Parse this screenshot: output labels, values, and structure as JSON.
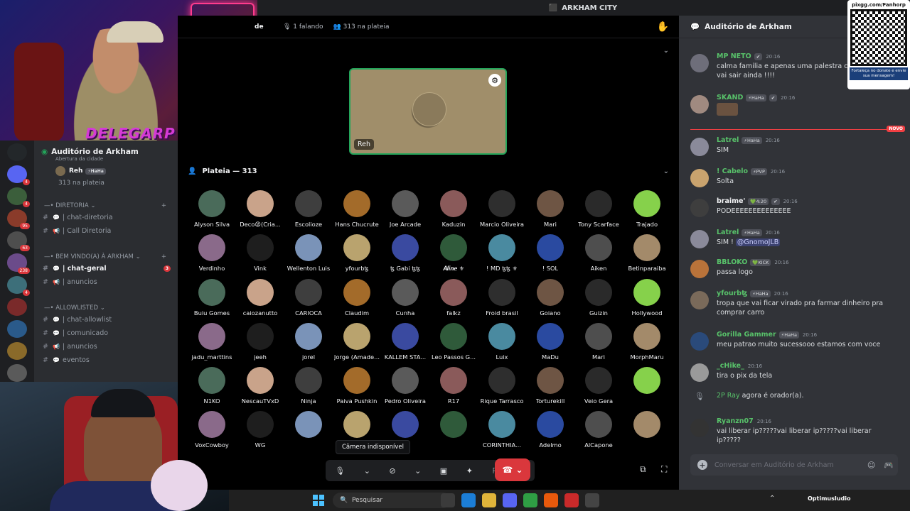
{
  "window": {
    "title": "ARKHAM CITY"
  },
  "overlay": {
    "brand": "DELEGARP"
  },
  "stage": {
    "title_fragment": "de",
    "speaking": "1 falando",
    "audience_count": "313 na plateia",
    "speaker": {
      "name": "Reh"
    },
    "audience_title": "Plateia — 313"
  },
  "sidebar": {
    "voice_channel": {
      "name": "Auditório de Arkham",
      "subtitle": "Abertura da cidade",
      "speaker": "Reh",
      "speaker_tag": "⚡HaHa",
      "audience": "313 na plateia"
    },
    "categories": [
      {
        "name": "DIRETORIA",
        "channels": [
          "| chat-diretoria",
          "| Call Diretoria"
        ]
      },
      {
        "name": "BEM VINDO(A) À ARKHAM",
        "channels": [
          "| chat-geral",
          "| anuncios"
        ]
      },
      {
        "name": "ALLOWLISTED",
        "channels": [
          "| chat-allowlist",
          "| comunicado",
          "| anuncios",
          "eventos"
        ]
      }
    ],
    "active_channel_mentions": "3",
    "server_badges": [
      "17",
      "4",
      "4",
      "95",
      "63",
      "238",
      "4"
    ]
  },
  "audience": [
    "Alyson Silva",
    "Deco😡(Cria...",
    "Escolioze",
    "Hans Chucrute",
    "Joe Arcade",
    "Kaduzin",
    "Marcio Oliveira",
    "Mari",
    "Tony Scarface",
    "Trajado",
    "Verdinho",
    "Vink",
    "Wellenton Luis",
    "yfourbꜩ",
    "ꜩ Gabi ꜩꜩ",
    "𝑨𝒍𝒊𝒏𝒆 ⚜",
    "! MD ꜩꜩ ⚜",
    "! SOL",
    "Aiken",
    "Betinparaiba",
    "Buiu Gomes",
    "caiozanutto",
    "CARIOCA",
    "Claudim",
    "Cunha",
    "falkz",
    "Froid brasil",
    "Goiano",
    "Guizin",
    "Hollywood",
    "jadu_marttins",
    "jeeh",
    "jorel",
    "Jorge (Amade...",
    "KALLEM STA...",
    "Leo Passos G...",
    "Luix",
    "MaDu",
    "Mari",
    "MorphMaru",
    "N1KO",
    "NescauTVxD",
    "Ninja",
    "Paiva Pushkin",
    "Pedro Oliveira",
    "R17",
    "Rique Tarrasco",
    "Torturekill",
    "Veio Gera",
    "",
    "VoxCowboy",
    "WG",
    "",
    "",
    "",
    "",
    "CORINTHIA...",
    "Adelmo",
    "AlCapone",
    ""
  ],
  "controls": {
    "tooltip": "Câmera indisponível"
  },
  "chat": {
    "title": "Auditório de Arkham",
    "new_label": "NOVO",
    "input_placeholder": "Conversar em Auditório de Arkham",
    "messages": [
      {
        "author": "MP NETO",
        "tags": [
          "✔"
        ],
        "time": "20:16",
        "color": "#58c26a",
        "text": "calma familia e apenas uma palestra com spoler vai sair ainda !!!!"
      },
      {
        "author": "SKAND",
        "tags": [
          "⚡HaHa",
          "✔"
        ],
        "time": "20:16",
        "color": "#58c26a",
        "text": ""
      },
      {
        "author": "Latrel",
        "tags": [
          "⚡HaHa"
        ],
        "time": "20:16",
        "color": "#58c26a",
        "text": "SIM"
      },
      {
        "author": "! Cabelo",
        "tags": [
          "⚡PVP"
        ],
        "time": "20:16",
        "color": "#58c26a",
        "text": "Solta"
      },
      {
        "author": "braime'",
        "tags": [
          "💚4:20",
          "✔"
        ],
        "time": "20:16",
        "color": "#f2f3f5",
        "text": "PODEEEEEEEEEEEEEE"
      },
      {
        "author": "Latrel",
        "tags": [
          "⚡HaHa"
        ],
        "time": "20:16",
        "color": "#58c26a",
        "text_prefix": "SIM ! ",
        "mention": "@GnomoJLB"
      },
      {
        "author": "BBLOKO",
        "tags": [
          "💚KICK"
        ],
        "time": "20:16",
        "color": "#58c26a",
        "text": "passa logo"
      },
      {
        "author": "yfourbꜩ",
        "tags": [
          "⚡HaHa"
        ],
        "time": "20:16",
        "color": "#58c26a",
        "text": "tropa que vai ficar virado pra farmar dinheiro pra comprar carro"
      },
      {
        "author": "Gorilla Gammer",
        "tags": [
          "⚡HaHa"
        ],
        "time": "20:16",
        "color": "#58c26a",
        "text": "meu patrao muito sucessooo estamos com voce"
      },
      {
        "author": "_cHike_",
        "tags": [],
        "time": "20:16",
        "color": "#58c26a",
        "text": "tira o pix da tela"
      },
      {
        "author": "2P Ray",
        "tags": [],
        "time": "",
        "color": "#58c26a",
        "system": "agora é orador(a).",
        "system_time": "20:16"
      },
      {
        "author": "Ryanzn07",
        "tags": [],
        "time": "20:16",
        "color": "#58c26a",
        "text": "vai liberar ip?????vai liberar ip?????vai liberar ip?????"
      }
    ]
  },
  "qr": {
    "url": "pixgg.com/Fanhorp",
    "note": "Fortaleça no donate e envie sua mensagem!"
  },
  "taskbar": {
    "search_placeholder": "Pesquisar",
    "streamer_app": "OptimusIudio"
  }
}
